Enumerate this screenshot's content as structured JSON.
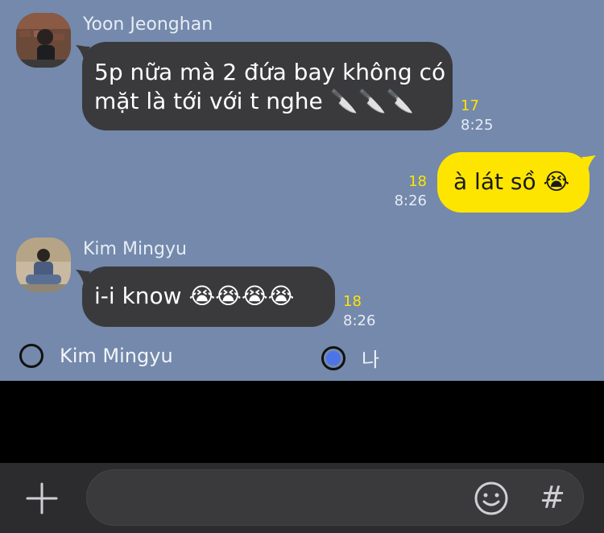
{
  "messages": [
    {
      "sender": "Yoon Jeonghan",
      "line1": "5p nữa mà 2 đứa bay không có",
      "line2": "mặt là tới với t nghe 🔪🔪🔪",
      "unread": "17",
      "time": "8:25"
    },
    {
      "sender": "",
      "text": "à lát sồ 😭",
      "unread": "18",
      "time": "8:26"
    },
    {
      "sender": "Kim Mingyu",
      "text": "i-i know 😭😭😭😭",
      "unread": "18",
      "time": "8:26"
    }
  ],
  "poll": {
    "options": [
      {
        "label": "Kim Mingyu",
        "selected": false
      },
      {
        "label": "나",
        "selected": true
      }
    ]
  },
  "input": {
    "value": "",
    "placeholder": ""
  },
  "icons": {
    "plus": "plus-icon",
    "emoji": "smiley-icon",
    "hash": "#"
  },
  "colors": {
    "chat_background": "#7489AB",
    "incoming_bubble": "#3A3A3C",
    "outgoing_bubble": "#FEE500",
    "unread_count": "#FEE500",
    "radio_selected": "#4B74E8"
  }
}
